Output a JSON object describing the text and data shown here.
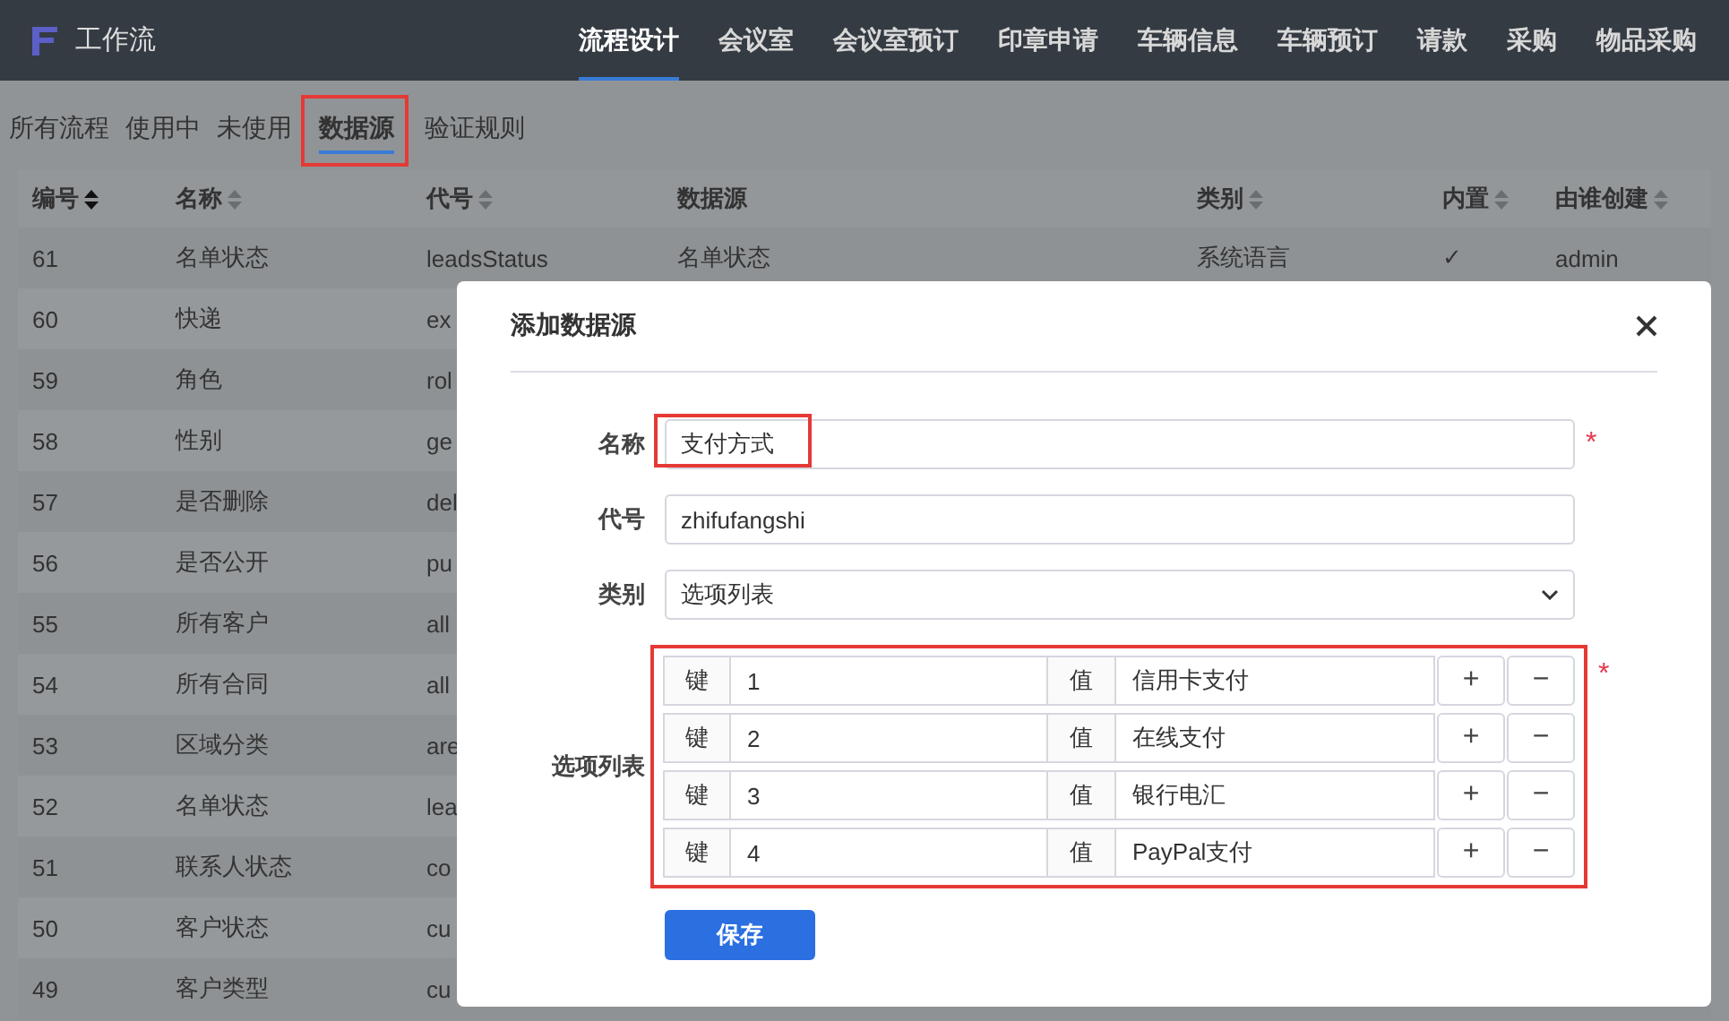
{
  "app": {
    "title": "工作流"
  },
  "top_nav": [
    {
      "label": "流程设计",
      "selected": true
    },
    {
      "label": "会议室",
      "selected": false
    },
    {
      "label": "会议室预订",
      "selected": false
    },
    {
      "label": "印章申请",
      "selected": false
    },
    {
      "label": "车辆信息",
      "selected": false
    },
    {
      "label": "车辆预订",
      "selected": false
    },
    {
      "label": "请款",
      "selected": false
    },
    {
      "label": "采购",
      "selected": false
    },
    {
      "label": "物品采购",
      "selected": false
    }
  ],
  "tabs": [
    {
      "label": "所有流程",
      "selected": false,
      "highlighted": false
    },
    {
      "label": "使用中",
      "selected": false,
      "highlighted": false
    },
    {
      "label": "未使用",
      "selected": false,
      "highlighted": false
    },
    {
      "label": "数据源",
      "selected": true,
      "highlighted": true
    },
    {
      "label": "验证规则",
      "selected": false,
      "highlighted": false
    }
  ],
  "table": {
    "columns": [
      {
        "label": "编号",
        "sortable": true,
        "sorted": true
      },
      {
        "label": "名称",
        "sortable": true,
        "sorted": false
      },
      {
        "label": "代号",
        "sortable": true,
        "sorted": false
      },
      {
        "label": "数据源",
        "sortable": false
      },
      {
        "label": "类别",
        "sortable": true,
        "sorted": false
      },
      {
        "label": "内置",
        "sortable": true,
        "sorted": false
      },
      {
        "label": "由谁创建",
        "sortable": true,
        "sorted": false
      }
    ],
    "rows": [
      {
        "cells": [
          "61",
          "名单状态",
          "leadsStatus",
          "名单状态",
          "系统语言",
          "✓",
          "admin"
        ]
      },
      {
        "cells": [
          "60",
          "快递",
          "ex"
        ]
      },
      {
        "cells": [
          "59",
          "角色",
          "rol"
        ]
      },
      {
        "cells": [
          "58",
          "性别",
          "ge"
        ]
      },
      {
        "cells": [
          "57",
          "是否删除",
          "del"
        ]
      },
      {
        "cells": [
          "56",
          "是否公开",
          "pu"
        ]
      },
      {
        "cells": [
          "55",
          "所有客户",
          "all"
        ]
      },
      {
        "cells": [
          "54",
          "所有合同",
          "all"
        ]
      },
      {
        "cells": [
          "53",
          "区域分类",
          "are"
        ]
      },
      {
        "cells": [
          "52",
          "名单状态",
          "lea"
        ]
      },
      {
        "cells": [
          "51",
          "联系人状态",
          "co"
        ]
      },
      {
        "cells": [
          "50",
          "客户状态",
          "cu"
        ]
      },
      {
        "cells": [
          "49",
          "客户类型",
          "cu"
        ]
      }
    ]
  },
  "dialog": {
    "title": "添加数据源",
    "fields": [
      {
        "kind": "text",
        "label": "名称",
        "value": "支付方式",
        "required_mark": "*",
        "highlighted": true
      },
      {
        "kind": "text",
        "label": "代号",
        "value": "zhifufangshi",
        "highlighted": false
      },
      {
        "kind": "select",
        "label": "类别",
        "value": "选项列表",
        "highlighted": false
      }
    ],
    "options": {
      "label": "选项列表",
      "highlighted": true,
      "required_mark": "*",
      "rows": [
        {
          "key_label": "键",
          "key": "1",
          "value_label": "值",
          "value": "信用卡支付",
          "add": "+",
          "remove": "−"
        },
        {
          "key_label": "键",
          "key": "2",
          "value_label": "值",
          "value": "在线支付",
          "add": "+",
          "remove": "−"
        },
        {
          "key_label": "键",
          "key": "3",
          "value_label": "值",
          "value": "银行电汇",
          "add": "+",
          "remove": "−"
        },
        {
          "key_label": "键",
          "key": "4",
          "value_label": "值",
          "value": "PayPal支付",
          "add": "+",
          "remove": "−"
        }
      ]
    },
    "save_button": "保存"
  }
}
